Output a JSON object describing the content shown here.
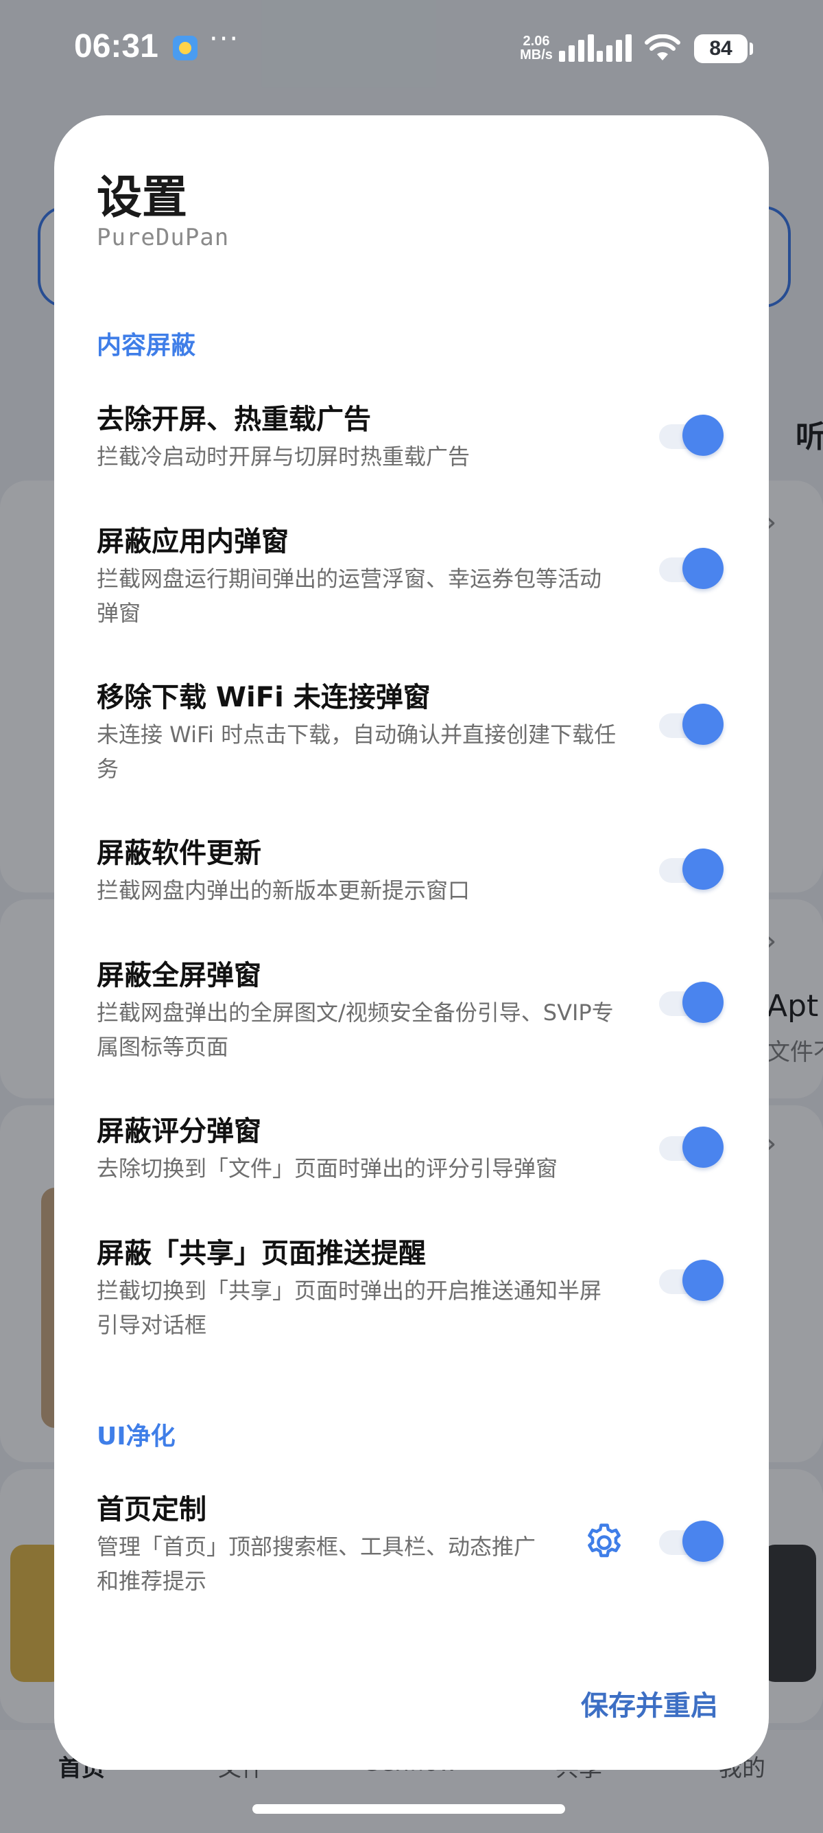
{
  "status_bar": {
    "time": "06:31",
    "more": "···",
    "net_speed_value": "2.06",
    "net_speed_unit": "MB/s",
    "battery": "84"
  },
  "background": {
    "nav_items": [
      "首页",
      "文件",
      "Genflow",
      "共享",
      "我的"
    ],
    "side_label_right": "Apt F",
    "side_sub_right": "文件不",
    "side_label_listen": "听"
  },
  "dialog": {
    "title": "设置",
    "subtitle": "PureDuPan",
    "sections": [
      {
        "header": "内容屏蔽",
        "items": [
          {
            "title": "去除开屏、热重载广告",
            "desc": "拦截冷启动时开屏与切屏时热重载广告",
            "enabled": true
          },
          {
            "title": "屏蔽应用内弹窗",
            "desc": "拦截网盘运行期间弹出的运营浮窗、幸运券包等活动弹窗",
            "enabled": true
          },
          {
            "title": "移除下载 WiFi 未连接弹窗",
            "desc": "未连接 WiFi 时点击下载，自动确认并直接创建下载任务",
            "enabled": true
          },
          {
            "title": "屏蔽软件更新",
            "desc": "拦截网盘内弹出的新版本更新提示窗口",
            "enabled": true
          },
          {
            "title": "屏蔽全屏弹窗",
            "desc": "拦截网盘弹出的全屏图文/视频安全备份引导、SVIP专属图标等页面",
            "enabled": true
          },
          {
            "title": "屏蔽评分弹窗",
            "desc": "去除切换到「文件」页面时弹出的评分引导弹窗",
            "enabled": true
          },
          {
            "title": "屏蔽「共享」页面推送提醒",
            "desc": "拦截切换到「共享」页面时弹出的开启推送通知半屏引导对话框",
            "enabled": true
          }
        ]
      },
      {
        "header": "UI净化",
        "items": [
          {
            "title": "首页定制",
            "desc": "管理「首页」顶部搜索框、工具栏、动态推广和推荐提示",
            "enabled": true
          }
        ]
      }
    ],
    "save_label": "保存并重启"
  },
  "colors": {
    "accent": "#4a84ee",
    "section_header": "#3f7ee8",
    "save_text": "#3d6fc4"
  }
}
